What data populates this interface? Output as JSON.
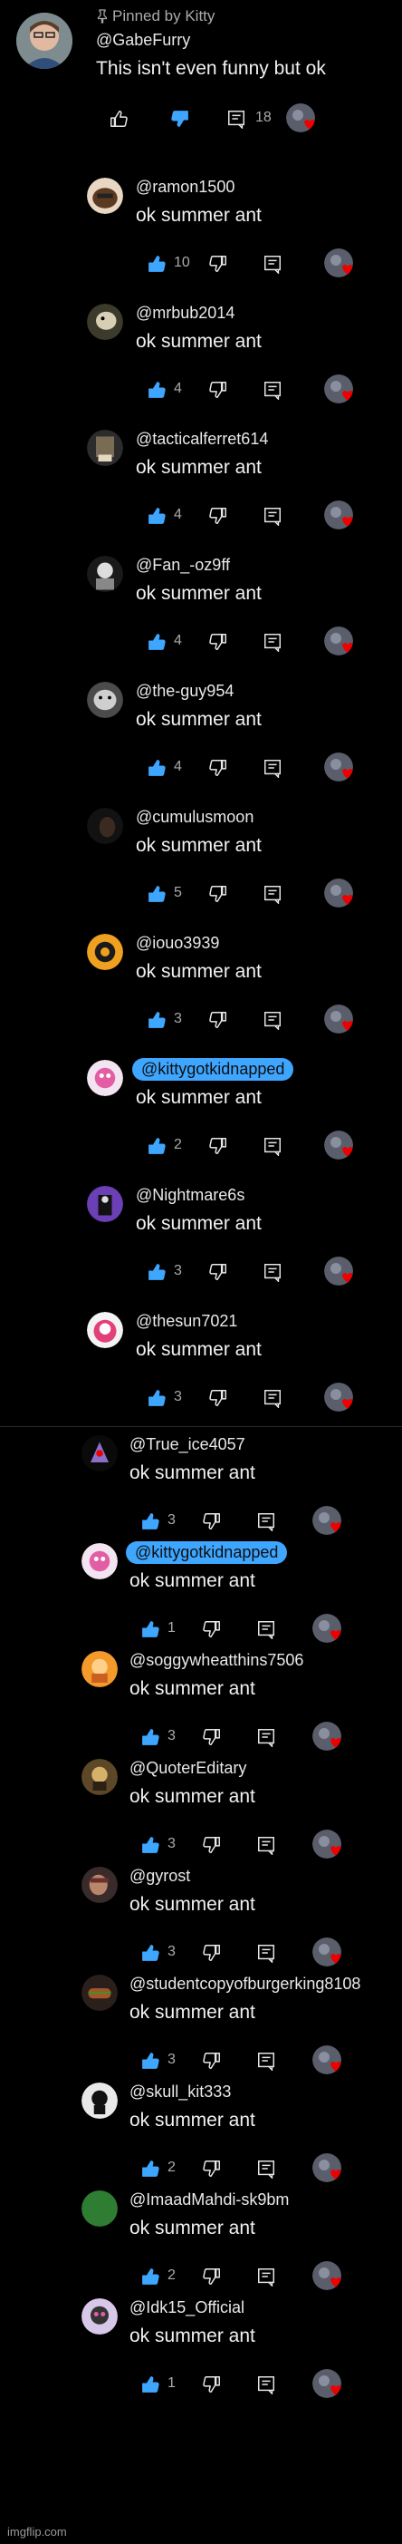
{
  "pinned": {
    "pin_label": "Pinned by Kitty",
    "author": "@GabeFurry",
    "text": "This isn't even funny but ok",
    "likes": "",
    "replies": "18"
  },
  "replies": [
    {
      "author": "@ramon1500",
      "text": "ok summer ant",
      "likes": "10",
      "mention": false
    },
    {
      "author": "@mrbub2014",
      "text": "ok summer ant",
      "likes": "4",
      "mention": false
    },
    {
      "author": "@tacticalferret614",
      "text": "ok summer ant",
      "likes": "4",
      "mention": false
    },
    {
      "author": "@Fan_-oz9ff",
      "text": "ok summer ant",
      "likes": "4",
      "mention": false
    },
    {
      "author": "@the-guy954",
      "text": "ok summer ant",
      "likes": "4",
      "mention": false
    },
    {
      "author": "@cumulusmoon",
      "text": "ok summer ant",
      "likes": "5",
      "mention": false
    },
    {
      "author": "@iouo3939",
      "text": "ok summer ant",
      "likes": "3",
      "mention": false
    },
    {
      "author": "@kittygotkidnapped",
      "text": "ok summer ant",
      "likes": "2",
      "mention": true
    },
    {
      "author": "@Nightmare6s",
      "text": "ok summer ant",
      "likes": "3",
      "mention": false
    },
    {
      "author": "@thesun7021",
      "text": "ok summer ant",
      "likes": "3",
      "mention": false
    },
    {
      "author": "@True_ice4057",
      "text": "ok summer ant",
      "likes": "3",
      "mention": false
    },
    {
      "author": "@kittygotkidnapped",
      "text": "ok summer ant",
      "likes": "1",
      "mention": true
    },
    {
      "author": "@soggywheatthins7506",
      "text": "ok summer ant",
      "likes": "3",
      "mention": false
    },
    {
      "author": "@QuoterEditary",
      "text": "ok summer ant",
      "likes": "3",
      "mention": false
    },
    {
      "author": "@gyrost",
      "text": "ok summer ant",
      "likes": "3",
      "mention": false
    },
    {
      "author": "@studentcopyofburgerking8108",
      "text": "ok summer ant",
      "likes": "3",
      "mention": false
    },
    {
      "author": "@skull_kit333",
      "text": "ok summer ant",
      "likes": "2",
      "mention": false
    },
    {
      "author": "@ImaadMahdi-sk9bm",
      "text": "ok summer ant",
      "likes": "2",
      "mention": false
    },
    {
      "author": "@Idk15_Official",
      "text": "ok summer ant",
      "likes": "1",
      "mention": false
    }
  ],
  "watermark": "imgflip.com",
  "colors": {
    "background": "#000000",
    "liked_blue": "#3ea6ff",
    "text": "#f1f1f1",
    "muted": "#aaaaaa"
  },
  "icons": [
    "pin-icon",
    "thumbs-up-icon",
    "thumbs-down-icon",
    "reply-icon",
    "creator-heart-icon"
  ]
}
